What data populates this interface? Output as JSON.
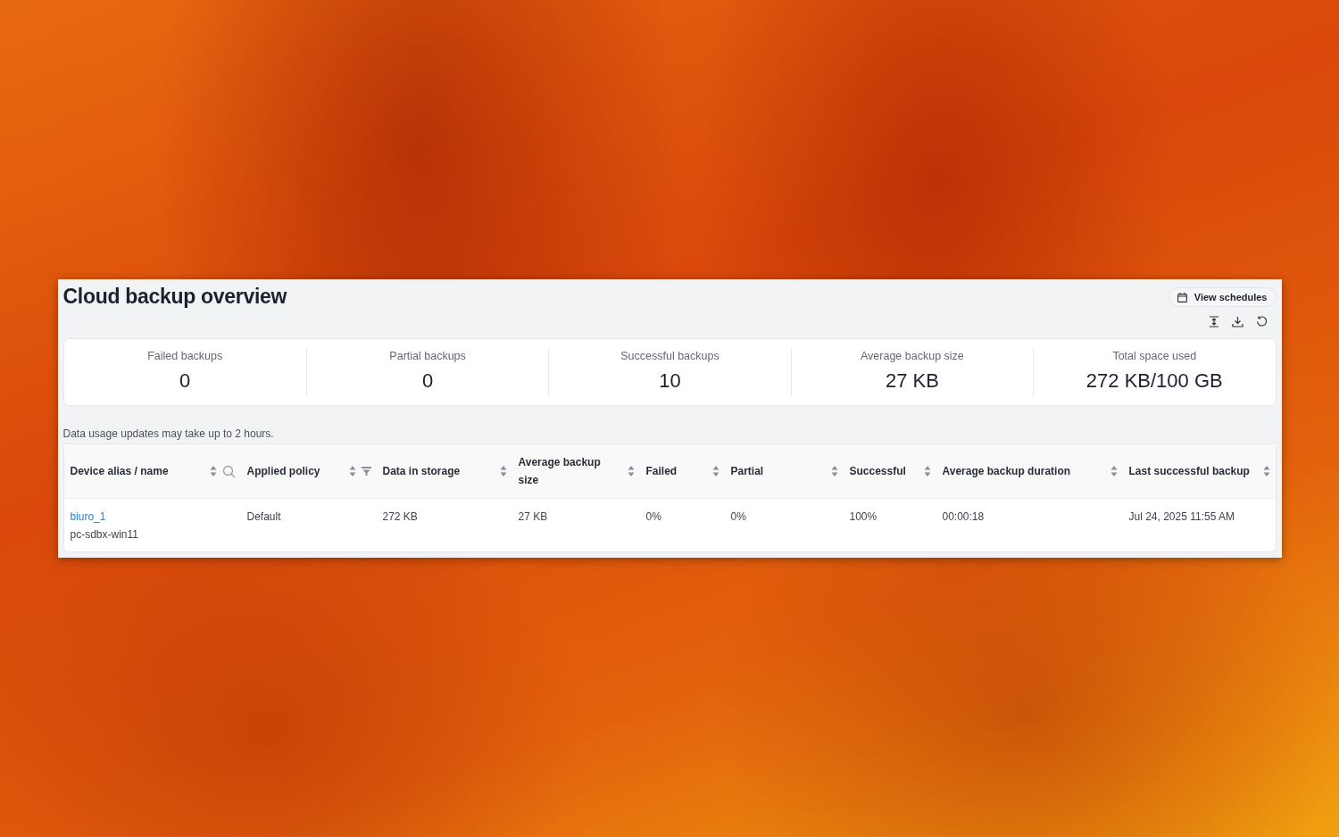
{
  "panel": {
    "title": "Cloud backup overview",
    "schedules_button": "View schedules"
  },
  "stats": [
    {
      "label": "Failed backups",
      "value": "0"
    },
    {
      "label": "Partial backups",
      "value": "0"
    },
    {
      "label": "Successful backups",
      "value": "10"
    },
    {
      "label": "Average backup size",
      "value": "27 KB"
    },
    {
      "label": "Total space used",
      "value": "272 KB/100 GB"
    }
  ],
  "note": "Data usage updates may take up to 2 hours.",
  "table": {
    "columns": [
      {
        "label": "Device alias / name",
        "kind": "searchable"
      },
      {
        "label": "Applied policy",
        "kind": "filterable"
      },
      {
        "label": "Data in storage",
        "kind": "plain"
      },
      {
        "label": "Average backup size",
        "kind": "plain"
      },
      {
        "label": "Failed",
        "kind": "plain"
      },
      {
        "label": "Partial",
        "kind": "plain"
      },
      {
        "label": "Successful",
        "kind": "plain"
      },
      {
        "label": "Average backup duration",
        "kind": "plain"
      },
      {
        "label": "Last successful backup",
        "kind": "plain"
      }
    ],
    "rows": [
      {
        "cells": [
          {
            "link": "biuro_1",
            "text": "pc-sdbx-win11"
          },
          {
            "text": "Default"
          },
          {
            "text": "272 KB"
          },
          {
            "text": "27 KB"
          },
          {
            "text": "0%"
          },
          {
            "text": "0%"
          },
          {
            "text": "100%"
          },
          {
            "text": "00:00:18"
          },
          {
            "text": "Jul 24, 2025 11:55 AM"
          }
        ]
      }
    ]
  }
}
